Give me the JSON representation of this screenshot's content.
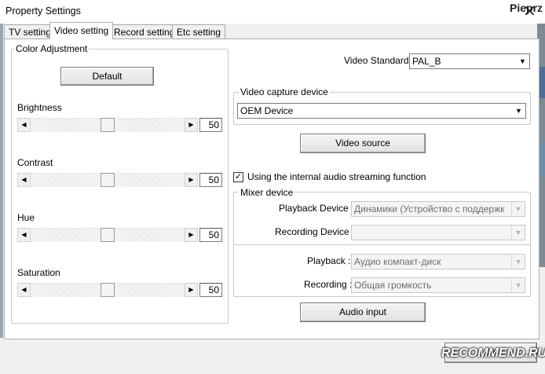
{
  "window": {
    "title": "Property Settings",
    "watermark_user": "Pieprz"
  },
  "tabs": [
    "TV setting",
    "Video setting",
    "Record setting",
    "Etc setting"
  ],
  "color_adjustment": {
    "group_label": "Color Adjustment",
    "default_button": "Default",
    "sliders": [
      {
        "label": "Brightness",
        "value": "50",
        "fraction": 0.5
      },
      {
        "label": "Contrast",
        "value": "50",
        "fraction": 0.5
      },
      {
        "label": "Hue",
        "value": "50",
        "fraction": 0.5
      },
      {
        "label": "Saturation",
        "value": "50",
        "fraction": 0.5
      }
    ]
  },
  "video": {
    "standard_label": "Video Standard :",
    "standard_value": "PAL_B",
    "capture_group_label": "Video capture device",
    "capture_device": "OEM Device",
    "video_source_button": "Video source",
    "audio_checkbox_label": "Using the internal audio streaming function",
    "audio_checkbox_checked": true
  },
  "mixer": {
    "group_label": "Mixer device",
    "playback_device_label": "Playback Device :",
    "playback_device_value": "Динамики (Устройство с поддержк",
    "recording_device_label": "Recording Device :",
    "recording_device_value": "",
    "playback_label": "Playback :",
    "playback_value": "Аудио компакт-диск",
    "recording_label": "Recording :",
    "recording_value": "Общая громкость"
  },
  "audio_input_button": "Audio input",
  "ok_button": "OK",
  "watermark": "RECOMMEND.RU",
  "icons": {
    "close": "close-icon",
    "check": "check-icon",
    "dropdown": "dropdown-arrow-icon"
  }
}
